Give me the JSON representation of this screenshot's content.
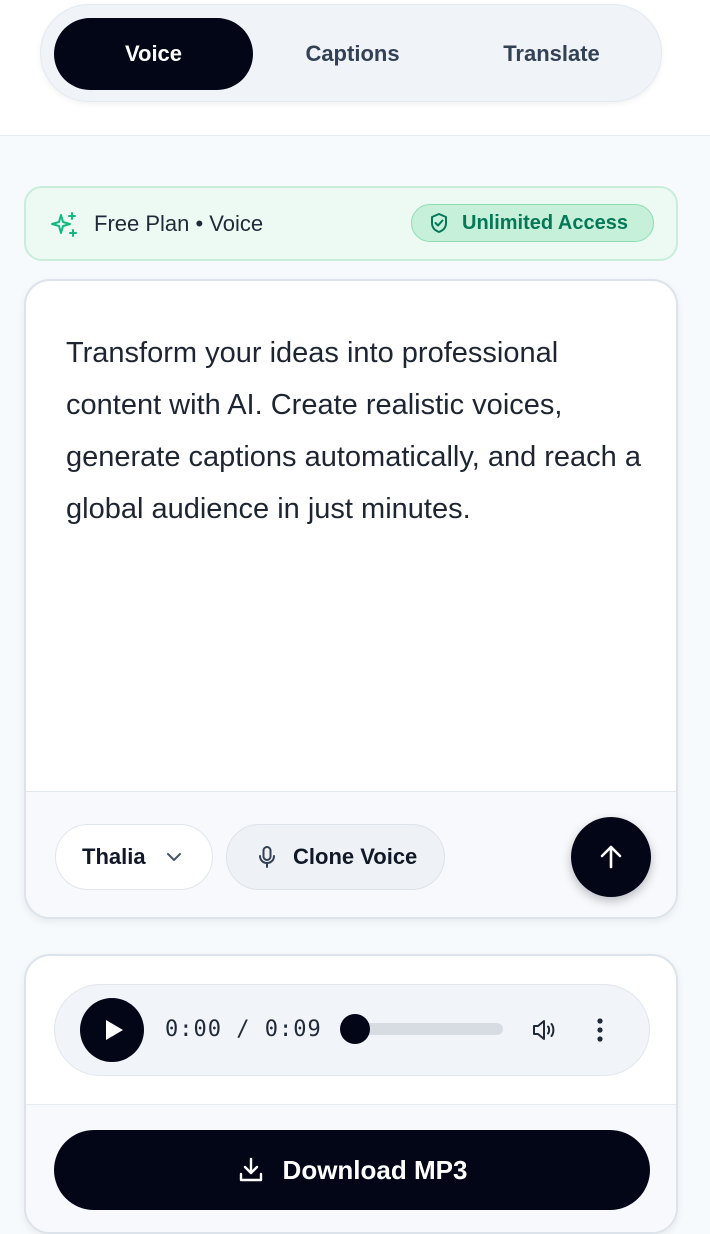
{
  "tabs": [
    {
      "label": "Voice",
      "active": true
    },
    {
      "label": "Captions",
      "active": false
    },
    {
      "label": "Translate",
      "active": false
    }
  ],
  "plan": {
    "label": "Free Plan • Voice",
    "badge": "Unlimited Access",
    "icon": "sparkles-icon"
  },
  "editor": {
    "text": "Transform your ideas into professional content with AI. Create realistic voices, generate captions automatically, and reach a global audience in just minutes."
  },
  "controls": {
    "voice": "Thalia",
    "clone_label": "Clone Voice"
  },
  "player": {
    "time": "0:00 / 0:09",
    "progress": 0.0
  },
  "download": {
    "label": "Download MP3"
  },
  "colors": {
    "primary": "#020617",
    "accent_green": "#047857",
    "banner_bg": "#ecfaf3",
    "badge_bg": "#c6f0d9"
  }
}
